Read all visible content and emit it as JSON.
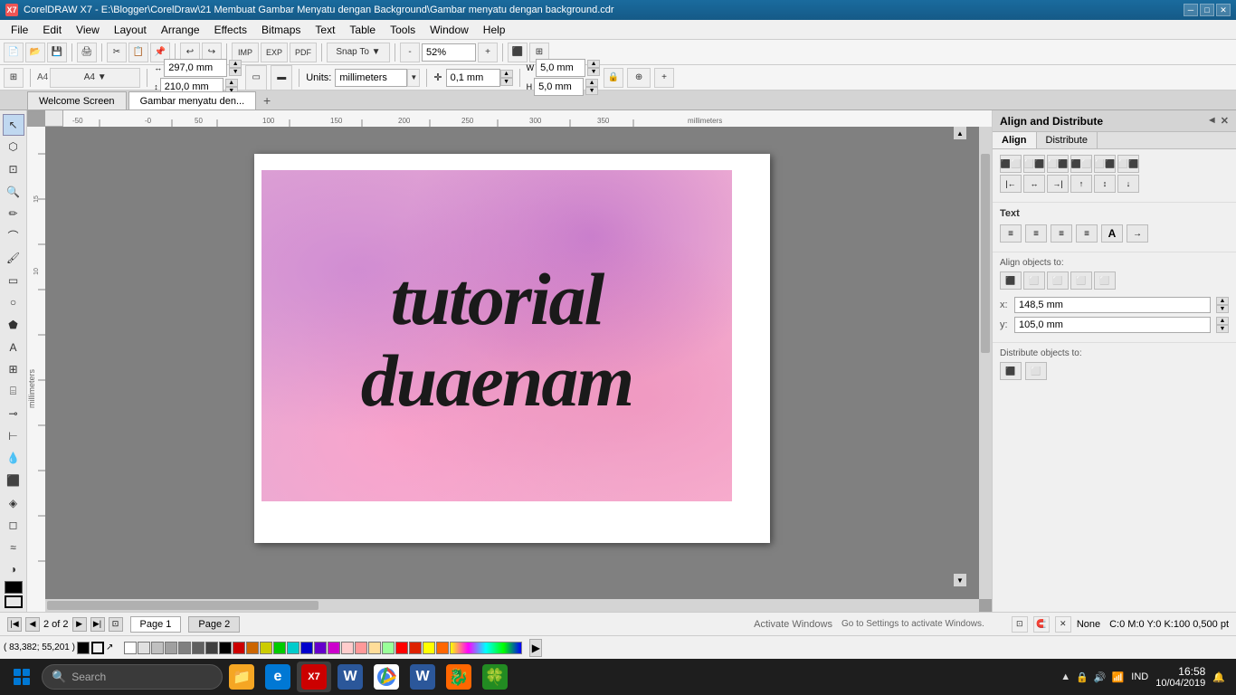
{
  "titlebar": {
    "icon_label": "X7",
    "title": "CorelDRAW X7 - E:\\Blogger\\CorelDraw\\21 Membuat Gambar Menyatu dengan Background\\Gambar menyatu dengan background.cdr",
    "min_btn": "─",
    "max_btn": "□",
    "close_btn": "✕"
  },
  "menubar": {
    "items": [
      "File",
      "Edit",
      "View",
      "Layout",
      "Arrange",
      "Effects",
      "Bitmaps",
      "Text",
      "Table",
      "Tools",
      "Window",
      "Help"
    ]
  },
  "toolbar1": {
    "buttons": [
      "New",
      "Open",
      "Save",
      "Print",
      "Cut",
      "Copy",
      "Paste",
      "Undo",
      "Redo"
    ],
    "zoom_label": "52%"
  },
  "toolbar2": {
    "width_label": "297,0 mm",
    "height_label": "210,0 mm",
    "units_label": "millimeters",
    "nudge_label": "0,1 mm",
    "w_label": "5,0 mm",
    "h_label": "5,0 mm"
  },
  "tabs": {
    "items": [
      "Welcome Screen",
      "Gambar menyatu den..."
    ],
    "active": 1,
    "add_label": "+"
  },
  "canvas": {
    "artwork_line1": "tutorial",
    "artwork_line2": "duaenam"
  },
  "right_panel": {
    "title": "Align and Distribute",
    "collapse_btn": "◄",
    "close_btn": "✕",
    "align_tab": "Align",
    "distribute_tab": "Distribute",
    "text_section": "Text",
    "align_objects_to": "Align objects to:",
    "x_label": "x:",
    "x_value": "148,5 mm",
    "y_label": "y:",
    "y_value": "105,0 mm",
    "distribute_objects_to": "Distribute objects to:",
    "align_buttons": [
      "⬜",
      "⬛",
      "⬜",
      "⬜",
      "⬜",
      "⬜",
      "⬜",
      "⬜",
      "⬜",
      "⬜",
      "⬜",
      "⬜",
      "⬜",
      "⬜",
      "⬜",
      "⬜",
      "⬜",
      "⬜"
    ],
    "align_icon_labels": [
      "align-left",
      "align-center-h",
      "align-right",
      "align-top",
      "align-center-v",
      "align-bottom"
    ],
    "distribute_icon_labels": [
      "dist-left",
      "dist-center-h",
      "dist-right",
      "dist-top",
      "dist-center-v",
      "dist-bottom",
      "dist-eq-h",
      "dist-eq-v"
    ]
  },
  "statusbar": {
    "page_info": "2 of 2",
    "page1_label": "Page 1",
    "page2_label": "Page 2",
    "arrow_first": "⏮",
    "arrow_prev": "◀",
    "arrow_next": "▶",
    "arrow_last": "⏭",
    "add_page": "+"
  },
  "colorbar": {
    "lock_icon": "🔒",
    "fill_label": "None",
    "watermark_label": "Activate Windows",
    "watermark_sub": "Go to Settings to activate Windows.",
    "status_label": "C:0 M:0 Y:0 K:100  0,500 pt",
    "coordinates": "( 83,382; 55,201 )",
    "palette_colors": [
      "#ffffff",
      "#e0e0e0",
      "#c0c0c0",
      "#a0a0a0",
      "#808080",
      "#606060",
      "#404040",
      "#202020",
      "#000000",
      "#ff0000",
      "#ff8800",
      "#ffff00",
      "#00ff00",
      "#00ffff",
      "#0000ff",
      "#8800ff",
      "#ff00ff",
      "#ffcccc",
      "#ff9999",
      "#ff6666"
    ]
  },
  "taskbar": {
    "search_placeholder": "Search",
    "apps": [
      {
        "name": "file-explorer",
        "color": "#f5a623",
        "label": "📁"
      },
      {
        "name": "edge-browser",
        "color": "#0078d4",
        "label": "e"
      },
      {
        "name": "coreldraw-app",
        "color": "#cc0000",
        "label": "X7"
      },
      {
        "name": "word-app",
        "color": "#2b579a",
        "label": "W"
      },
      {
        "name": "chrome-browser",
        "color": "#ea4335",
        "label": "●"
      },
      {
        "name": "word-app2",
        "color": "#2b579a",
        "label": "W"
      },
      {
        "name": "app7",
        "color": "#008000",
        "label": "◆"
      },
      {
        "name": "app8",
        "color": "#228B22",
        "label": "▲"
      }
    ],
    "time": "16:58",
    "date": "10/04/2019",
    "language": "IND",
    "notifications": "🔔"
  }
}
